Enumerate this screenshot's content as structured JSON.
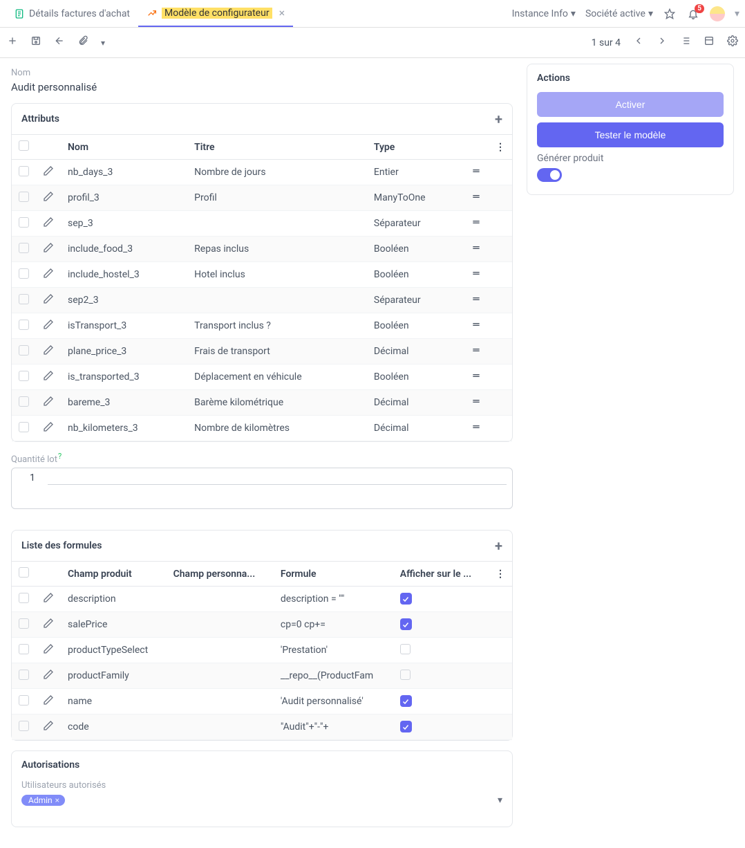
{
  "tabs": {
    "prev": {
      "label": "Détails factures d'achat"
    },
    "active": {
      "label": "Modèle de configurateur"
    }
  },
  "topmenu": {
    "instance": "Instance Info",
    "company": "Société active",
    "notif_count": "5"
  },
  "toolbar": {
    "pager": "1 sur 4"
  },
  "nom": {
    "label": "Nom",
    "value": "Audit personnalisé"
  },
  "attributs": {
    "title": "Attributs",
    "columns": {
      "nom": "Nom",
      "titre": "Titre",
      "type": "Type"
    },
    "rows": [
      {
        "nom": "nb_days_3",
        "titre": "Nombre de jours",
        "type": "Entier"
      },
      {
        "nom": "profil_3",
        "titre": "Profil",
        "type": "ManyToOne"
      },
      {
        "nom": "sep_3",
        "titre": "",
        "type": "Séparateur"
      },
      {
        "nom": "include_food_3",
        "titre": "Repas inclus",
        "type": "Booléen"
      },
      {
        "nom": "include_hostel_3",
        "titre": "Hotel inclus",
        "type": "Booléen"
      },
      {
        "nom": "sep2_3",
        "titre": "",
        "type": "Séparateur"
      },
      {
        "nom": "isTransport_3",
        "titre": "Transport inclus ?",
        "type": "Booléen"
      },
      {
        "nom": "plane_price_3",
        "titre": "Frais de transport",
        "type": "Décimal"
      },
      {
        "nom": "is_transported_3",
        "titre": "Déplacement en véhicule",
        "type": "Booléen"
      },
      {
        "nom": "bareme_3",
        "titre": "Barème kilométrique",
        "type": "Décimal"
      },
      {
        "nom": "nb_kilometers_3",
        "titre": "Nombre de kilomètres",
        "type": "Décimal"
      }
    ]
  },
  "qlot": {
    "label": "Quantité lot",
    "value": "1"
  },
  "formulas": {
    "title": "Liste des formules",
    "columns": {
      "field": "Champ produit",
      "custom": "Champ personna...",
      "formula": "Formule",
      "show": "Afficher sur le ..."
    },
    "rows": [
      {
        "field": "description",
        "custom": "",
        "formula": "description = \"\"",
        "show": true
      },
      {
        "field": "salePrice",
        "custom": "",
        "formula": "cp=0 cp+=",
        "show": true
      },
      {
        "field": "productTypeSelect",
        "custom": "",
        "formula": "'Prestation'",
        "show": false
      },
      {
        "field": "productFamily",
        "custom": "",
        "formula": "__repo__(ProductFam",
        "show": false
      },
      {
        "field": "name",
        "custom": "",
        "formula": "'Audit personnalisé'",
        "show": true
      },
      {
        "field": "code",
        "custom": "",
        "formula": "\"Audit\"+\"-\"+",
        "show": true
      }
    ]
  },
  "auth": {
    "title": "Autorisations",
    "users_label": "Utilisateurs autorisés",
    "user": "Admin"
  },
  "actions": {
    "title": "Actions",
    "activate": "Activer",
    "test": "Tester le modèle",
    "generate_label": "Générer produit"
  }
}
